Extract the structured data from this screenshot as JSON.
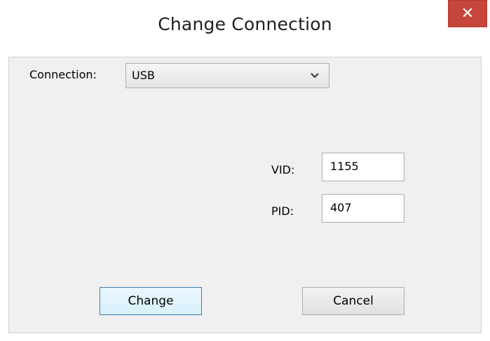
{
  "window": {
    "title": "Change Connection",
    "close_label": "✕"
  },
  "form": {
    "connection_label": "Connection:",
    "connection_value": "USB",
    "vid_label": "VID:",
    "vid_value": "1155",
    "pid_label": "PID:",
    "pid_value": "407"
  },
  "buttons": {
    "change_label": "Change",
    "cancel_label": "Cancel"
  },
  "colors": {
    "close_button": "#c7463b",
    "default_button_border": "#3c7fb1",
    "dialog_background": "#f0f0f0"
  }
}
